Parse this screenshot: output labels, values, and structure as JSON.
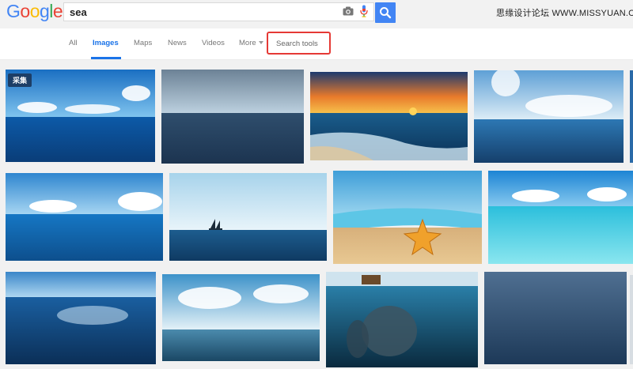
{
  "header": {
    "logo_letters": [
      "G",
      "o",
      "o",
      "g",
      "l",
      "e"
    ],
    "logo_colors": [
      "#4285f4",
      "#ea4335",
      "#fbbc05",
      "#4285f4",
      "#34a853",
      "#ea4335"
    ],
    "search_value": "sea",
    "watermark": "思缘设计论坛 WWW.MISSYUAN.COM"
  },
  "nav": {
    "tabs": [
      "All",
      "Images",
      "Maps",
      "News",
      "Videos",
      "More"
    ],
    "active_tab": "Images",
    "search_tools": "Search tools"
  },
  "results": {
    "badge": "采集",
    "images": [
      {
        "desc": "sea-horizon-clouds"
      },
      {
        "desc": "grey-calm-sea"
      },
      {
        "desc": "sunset-beach-waves"
      },
      {
        "desc": "sun-clouds-sea"
      },
      {
        "desc": "blue-sea-clouds"
      },
      {
        "desc": "sea-sailboat"
      },
      {
        "desc": "starfish-beach"
      },
      {
        "desc": "turquoise-water"
      },
      {
        "desc": "sparkling-sea"
      },
      {
        "desc": "cloud-sea"
      },
      {
        "desc": "underwater-shipwreck"
      },
      {
        "desc": "dark-sea-waves"
      }
    ]
  }
}
